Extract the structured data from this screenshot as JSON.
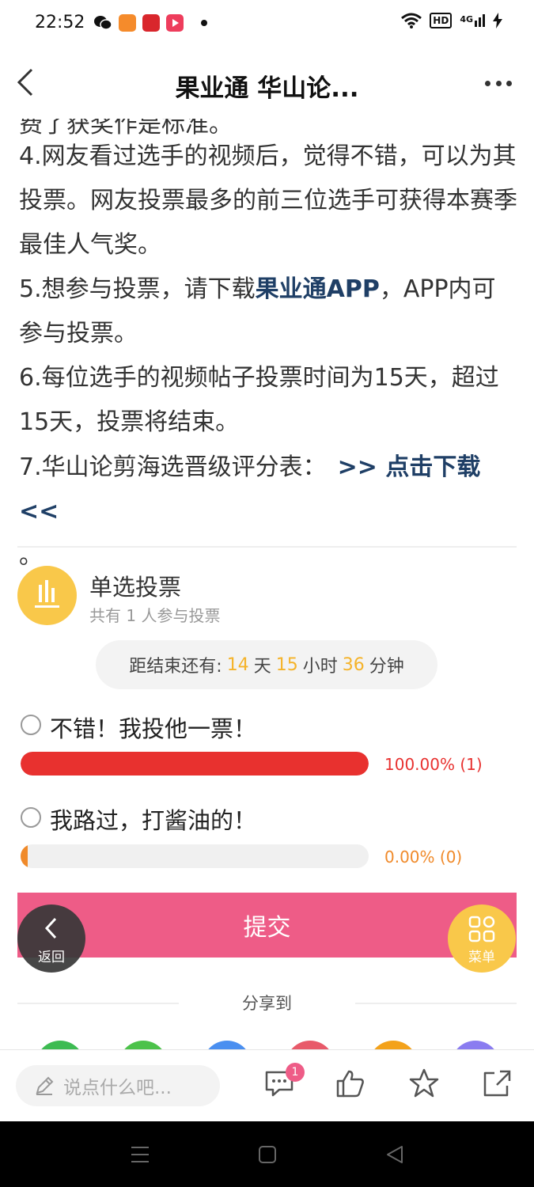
{
  "status_bar": {
    "time": "22:52",
    "hd": "HD",
    "network": "4G"
  },
  "header": {
    "title": "果业通 华山论..."
  },
  "article": {
    "cut_line": "费了获奖作是标准。",
    "item4": "4.网友看过选手的视频后，觉得不错，可以为其投票。网友投票最多的前三位选手可获得本赛季最佳人气奖。",
    "item5_pre": "5.想参与投票，请下载",
    "item5_link": "果业通APP",
    "item5_post": "，APP内可参与投票。",
    "item6": "6.每位选手的视频帖子投票时间为15天，超过15天，投票将结束。",
    "item7_pre": "7.华山论剪海选晋级评分表：",
    "item7_link": ">> 点击下载 <<",
    "item7_post": "。"
  },
  "poll": {
    "type_label": "单选投票",
    "participants": "共有 1 人参与投票",
    "countdown": {
      "prefix": "距结束还有:",
      "days": "14",
      "days_unit": "天",
      "hours": "15",
      "hours_unit": "小时",
      "minutes": "36",
      "minutes_unit": "分钟"
    },
    "options": [
      {
        "label": "不错！我投他一票！",
        "percent_text": "100.00% (1)",
        "fraction": 1.0,
        "color": "#e8312f"
      },
      {
        "label": "我路过，打酱油的！",
        "percent_text": "0.00% (0)",
        "fraction": 0.0,
        "color": "#f08a2a"
      }
    ],
    "submit_label": "提交"
  },
  "share": {
    "label": "分享到",
    "colors": [
      "#3dbb52",
      "#4cc24a",
      "#4a8ff0",
      "#e85a6a",
      "#f3a21b",
      "#8a7cf0"
    ]
  },
  "floating": {
    "back_label": "返回",
    "menu_label": "菜单"
  },
  "bottom_bar": {
    "comment_placeholder": "说点什么吧...",
    "comment_badge": "1"
  },
  "colors": {
    "accent_yellow": "#f9c84a",
    "submit_pink": "#ee5c87",
    "link_blue": "#1f3f66"
  }
}
